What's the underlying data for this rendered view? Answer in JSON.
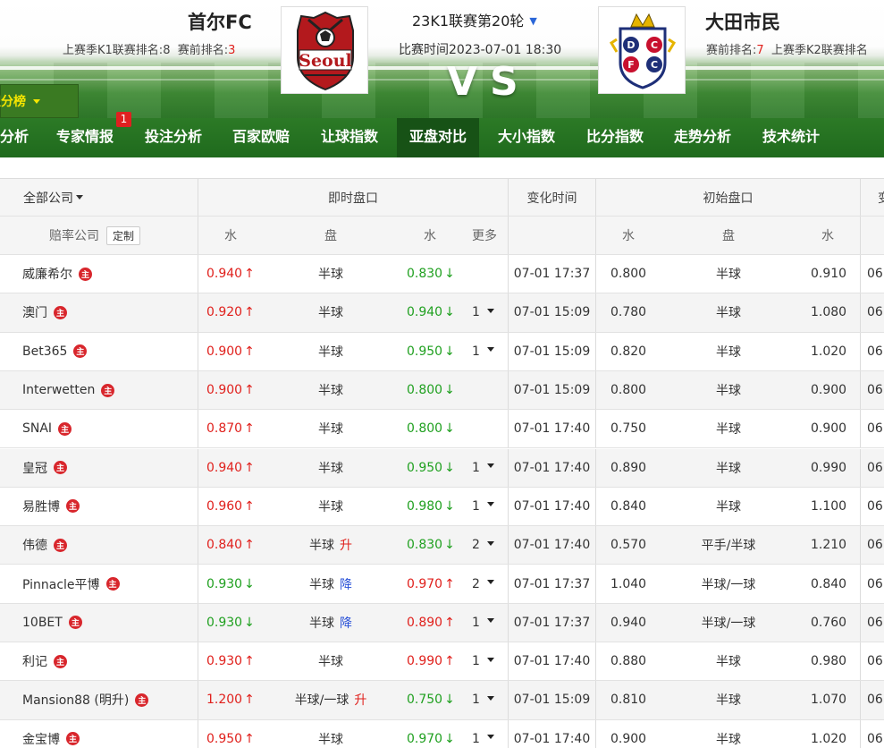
{
  "header": {
    "home_team": "首尔FC",
    "home_last_season_label": "上赛季K1联赛排名:",
    "home_last_season_rank": "8",
    "home_pre_label": "赛前排名:",
    "home_pre_rank": "3",
    "away_team": "大田市民",
    "away_pre_label": "赛前排名:",
    "away_pre_rank": "7",
    "away_last_season_label": "上赛季K2联赛排名",
    "round": "23K1联赛第20轮",
    "match_time": "比赛时间2023-07-01 18:30",
    "vs": "VS",
    "home_logo_text": "Seoul",
    "away_logo_text": "DCFC"
  },
  "rank_tab": "积分榜",
  "nav": {
    "items": [
      "分析",
      "专家情报",
      "投注分析",
      "百家欧赔",
      "让球指数",
      "亚盘对比",
      "大小指数",
      "比分指数",
      "走势分析",
      "技术统计"
    ],
    "active": "亚盘对比",
    "badge": "1"
  },
  "table": {
    "company_filter": "全部公司",
    "live_group": "即时盘口",
    "change_time": "变化时间",
    "initial_group": "初始盘口",
    "last_group": "变",
    "sub": {
      "company": "赔率公司",
      "custom": "定制",
      "water": "水",
      "line": "盘",
      "more": "更多"
    },
    "zhu_icon": "主",
    "rows": [
      {
        "company": "威廉希尔",
        "hw": "0.940",
        "hd": "up",
        "line": "半球",
        "lt": "",
        "aw": "0.830",
        "ad": "down",
        "more": "",
        "time": "07-01 17:37",
        "i_hw": "0.800",
        "i_line": "半球",
        "i_aw": "0.910",
        "last": "06"
      },
      {
        "company": "澳门",
        "hw": "0.920",
        "hd": "up",
        "line": "半球",
        "lt": "",
        "aw": "0.940",
        "ad": "down",
        "more": "1",
        "time": "07-01 15:09",
        "i_hw": "0.780",
        "i_line": "半球",
        "i_aw": "1.080",
        "last": "06"
      },
      {
        "company": "Bet365",
        "hw": "0.900",
        "hd": "up",
        "line": "半球",
        "lt": "",
        "aw": "0.950",
        "ad": "down",
        "more": "1",
        "time": "07-01 15:09",
        "i_hw": "0.820",
        "i_line": "半球",
        "i_aw": "1.020",
        "last": "06"
      },
      {
        "company": "Interwetten",
        "hw": "0.900",
        "hd": "up",
        "line": "半球",
        "lt": "",
        "aw": "0.800",
        "ad": "down",
        "more": "",
        "time": "07-01 15:09",
        "i_hw": "0.800",
        "i_line": "半球",
        "i_aw": "0.900",
        "last": "06"
      },
      {
        "company": "SNAI",
        "hw": "0.870",
        "hd": "up",
        "line": "半球",
        "lt": "",
        "aw": "0.800",
        "ad": "down",
        "more": "",
        "time": "07-01 17:40",
        "i_hw": "0.750",
        "i_line": "半球",
        "i_aw": "0.900",
        "last": "06"
      },
      {
        "company": "皇冠",
        "hw": "0.940",
        "hd": "up",
        "line": "半球",
        "lt": "",
        "aw": "0.950",
        "ad": "down",
        "more": "1",
        "time": "07-01 17:40",
        "i_hw": "0.890",
        "i_line": "半球",
        "i_aw": "0.990",
        "last": "06"
      },
      {
        "company": "易胜博",
        "hw": "0.960",
        "hd": "up",
        "line": "半球",
        "lt": "",
        "aw": "0.980",
        "ad": "down",
        "more": "1",
        "time": "07-01 17:40",
        "i_hw": "0.840",
        "i_line": "半球",
        "i_aw": "1.100",
        "last": "06"
      },
      {
        "company": "伟德",
        "hw": "0.840",
        "hd": "up",
        "line": "半球",
        "lt": "升",
        "aw": "0.830",
        "ad": "down",
        "more": "2",
        "time": "07-01 17:40",
        "i_hw": "0.570",
        "i_line": "平手/半球",
        "i_aw": "1.210",
        "last": "06"
      },
      {
        "company": "Pinnacle平博",
        "hw": "0.930",
        "hd": "down",
        "line": "半球",
        "lt": "降",
        "aw": "0.970",
        "ad": "up",
        "more": "2",
        "time": "07-01 17:37",
        "i_hw": "1.040",
        "i_line": "半球/一球",
        "i_aw": "0.840",
        "last": "06"
      },
      {
        "company": "10BET",
        "hw": "0.930",
        "hd": "down",
        "line": "半球",
        "lt": "降",
        "aw": "0.890",
        "ad": "up",
        "more": "1",
        "time": "07-01 17:37",
        "i_hw": "0.940",
        "i_line": "半球/一球",
        "i_aw": "0.760",
        "last": "06"
      },
      {
        "company": "利记",
        "hw": "0.930",
        "hd": "up",
        "line": "半球",
        "lt": "",
        "aw": "0.990",
        "ad": "up",
        "more": "1",
        "time": "07-01 17:40",
        "i_hw": "0.880",
        "i_line": "半球",
        "i_aw": "0.980",
        "last": "06"
      },
      {
        "company": "Mansion88 (明升)",
        "hw": "1.200",
        "hd": "up",
        "line": "半球/一球",
        "lt": "升",
        "aw": "0.750",
        "ad": "down",
        "more": "1",
        "time": "07-01 15:09",
        "i_hw": "0.810",
        "i_line": "半球",
        "i_aw": "1.070",
        "last": "06"
      },
      {
        "company": "金宝博",
        "hw": "0.950",
        "hd": "up",
        "line": "半球",
        "lt": "",
        "aw": "0.970",
        "ad": "down",
        "more": "1",
        "time": "07-01 17:40",
        "i_hw": "0.900",
        "i_line": "半球",
        "i_aw": "1.020",
        "last": "06"
      }
    ]
  }
}
